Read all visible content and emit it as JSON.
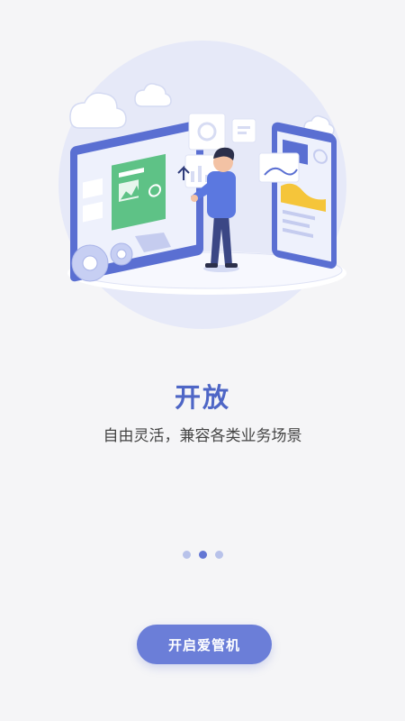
{
  "slide": {
    "title": "开放",
    "subtitle": "自由灵活，兼容各类业务场景"
  },
  "pager": {
    "total": 3,
    "active_index": 1
  },
  "start_button": {
    "label": "开启爱管机"
  },
  "colors": {
    "accent": "#4e66c6",
    "button": "#6b7ed8",
    "dot_inactive": "#b8c2ea",
    "dot_active": "#6477d4",
    "background": "#f5f5f7"
  },
  "illustration": {
    "icon": "open-platform-illustration"
  }
}
